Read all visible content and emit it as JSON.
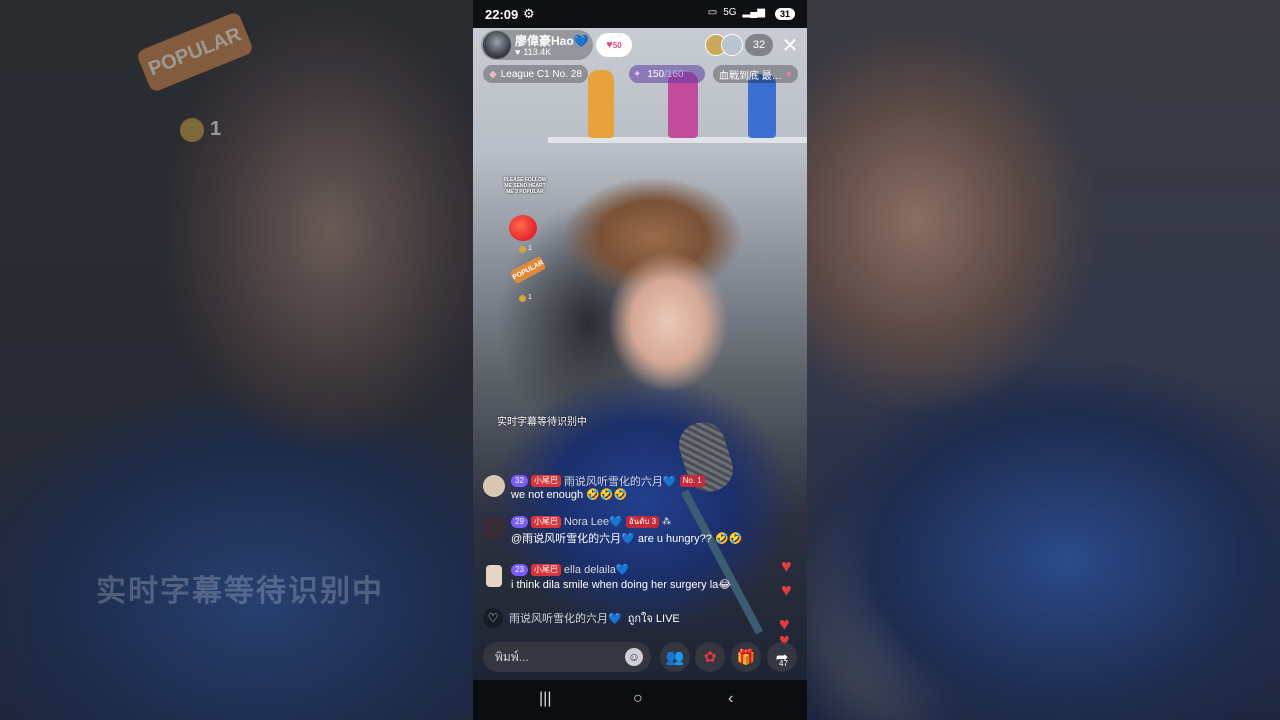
{
  "background": {
    "caption_text": "实时字幕等待识别中",
    "popular_sticker": "POPULAR",
    "coin_count": "1"
  },
  "status_bar": {
    "time": "22:09",
    "network": "5G",
    "battery": "31"
  },
  "host": {
    "name": "廖偉豪Hao💙",
    "likes": "113.4K",
    "follow_badge": "50"
  },
  "viewers": {
    "count": "32"
  },
  "league": {
    "label": "League C1 No. 28"
  },
  "goal": {
    "current": "150",
    "total": "/160"
  },
  "battle": {
    "label": "血戰到底 最…"
  },
  "stickers": {
    "text": "PLEASE FOLLOW ME SEND HEART ME 3 POPULAR",
    "heart_count": "1",
    "popular_label": "POPULAR",
    "popular_count": "1"
  },
  "live_caption": "实时字幕等待识别中",
  "comments": [
    {
      "level": "32",
      "fan_badge": "小尾巴",
      "user": "雨说风听雪化的六月💙",
      "rank": "No. 1",
      "text": "we not enough 🤣🤣🤣"
    },
    {
      "level": "29",
      "fan_badge": "小尾巴",
      "user": "Nora Lee💙",
      "rank": "อันดับ 3",
      "text": "@雨说风听雪化的六月💙 are u hungry?? 🤣🤣"
    },
    {
      "level": "23",
      "fan_badge": "小尾巴",
      "user": "ella delaila💙",
      "text": "i think dila smile when doing her surgery la😂"
    }
  ],
  "notice": {
    "user": "雨说风听雪化的六月💙",
    "action": "ถูกใจ LIVE"
  },
  "bottom_bar": {
    "input_placeholder": "พิมพ์...",
    "share_count": "47"
  },
  "colors": {
    "level_badge": "#7a5cff",
    "fan_badge": "#d8343c",
    "heart": "#e63a3a",
    "goal_bg": "#5c3ca0"
  }
}
